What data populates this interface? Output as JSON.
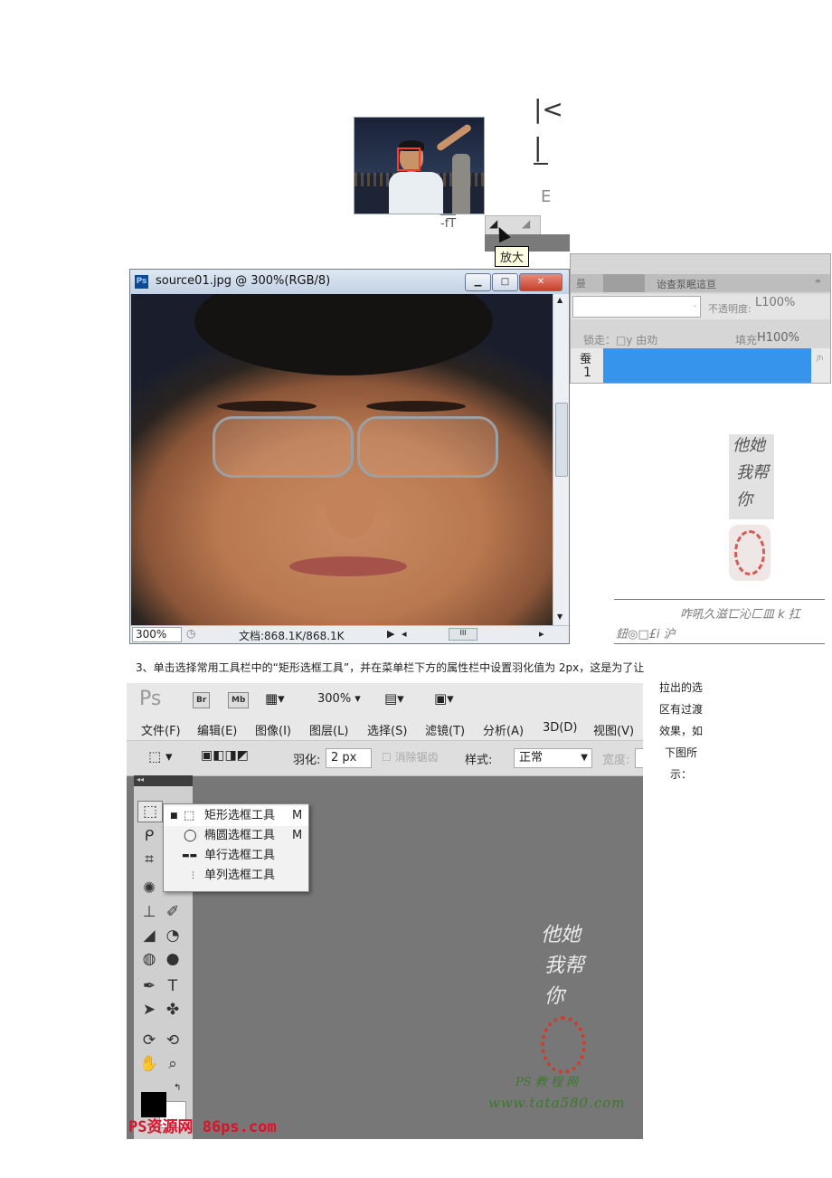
{
  "top": {
    "glyph1": "|<",
    "glyph2": "|",
    "glyph3": "E",
    "nav_under": "-fT",
    "tooltip": "放大"
  },
  "source_window": {
    "title": "source01.jpg @ 300%(RGB/8)",
    "zoom": "300%",
    "doc": "文档:868.1K/868.1K"
  },
  "layers_panel": {
    "tab1": "曼",
    "tab2": "诒查泵眠這亘",
    "opacity_label": "不透明度:",
    "opacity_value": "L100%",
    "lock_label": "锁走：□y 由劝",
    "fill_label": "填充",
    "fill_value": "H100%",
    "layer_label_top": "蚕",
    "layer_label_bottom": "1",
    "panel_icon": "Jh"
  },
  "watermark_stamp": {
    "calligraphy": [
      "他她",
      "我帮",
      "你"
    ]
  },
  "caption": {
    "line1": "咋吼久滋匸沁匚皿 k 扛",
    "line2": "鈕◎□£i 沪"
  },
  "paragraph": "3、单击选择常用工具栏中的“矩形选框工具”，并在菜单栏下方的属性栏中设置羽化值为 2px，这是为了让",
  "side_text": [
    "拉出的选",
    "区有过渡",
    "效果，如",
    "下图所",
    "示："
  ],
  "ps": {
    "logo": "Ps",
    "br": "Br",
    "mb": "Mb",
    "zoom": "300%",
    "menu": [
      "文件(F)",
      "编辑(E)",
      "图像(I)",
      "图层(L)",
      "选择(S)",
      "滤镜(T)",
      "分析(A)",
      "3D(D)",
      "视图(V)"
    ],
    "feather_label": "羽化:",
    "feather_value": "2 px",
    "antialias": "消除锯齿",
    "style_label": "样式:",
    "style_value": "正常",
    "width_label": "宽度:",
    "flyout": [
      {
        "label": "矩形选框工具",
        "key": "M"
      },
      {
        "label": "椭圆选框工具",
        "key": "M"
      },
      {
        "label": "单行选框工具",
        "key": ""
      },
      {
        "label": "单列选框工具",
        "key": ""
      }
    ],
    "logo86": "PS资源网 86ps.com",
    "wm_ps": "PS 教 程 网",
    "wm_url": "www.tata580.com"
  },
  "colors": {
    "canvas_bg": "#777777",
    "layer_blue": "#3794ec",
    "close_red": "#c4412c",
    "logo_red": "#e0102a",
    "wm_green": "#3b7a2a"
  }
}
